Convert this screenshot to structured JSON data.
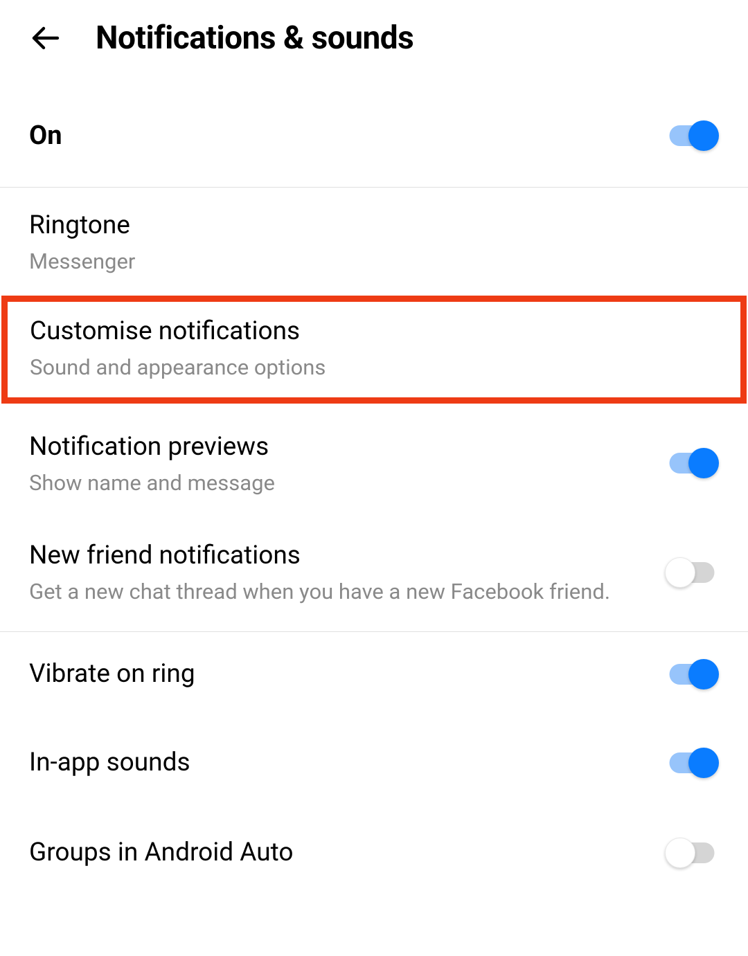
{
  "header": {
    "title": "Notifications & sounds"
  },
  "master": {
    "label": "On",
    "enabled": true
  },
  "items": {
    "ringtone": {
      "label": "Ringtone",
      "description": "Messenger"
    },
    "customise": {
      "label": "Customise notifications",
      "description": "Sound and appearance options"
    },
    "previews": {
      "label": "Notification previews",
      "description": "Show name and message",
      "enabled": true
    },
    "newfriend": {
      "label": "New friend notifications",
      "description": "Get a new chat thread when you have a new Facebook friend.",
      "enabled": false
    },
    "vibrate": {
      "label": "Vibrate on ring",
      "enabled": true
    },
    "inapp": {
      "label": "In-app sounds",
      "enabled": true
    },
    "groups": {
      "label": "Groups in Android Auto",
      "enabled": false
    }
  }
}
